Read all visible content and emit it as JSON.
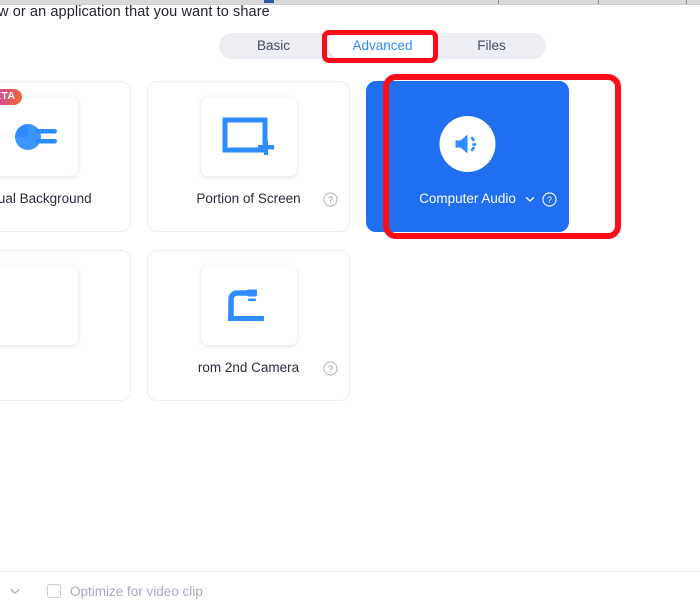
{
  "header": {
    "title": "w or an application that you want to share"
  },
  "tabs": {
    "items": [
      {
        "label": "Basic",
        "active": false
      },
      {
        "label": "Advanced",
        "active": true
      },
      {
        "label": "Files",
        "active": false
      }
    ],
    "active_label": "Advanced"
  },
  "cards": [
    {
      "label": "s Virtual Background",
      "icon": "slides-virtual-background-icon",
      "badge": "BETA",
      "selected": false,
      "has_help": false,
      "has_chevron": false
    },
    {
      "label": "Portion of Screen",
      "icon": "portion-of-screen-icon",
      "badge": null,
      "selected": false,
      "has_help": true,
      "has_chevron": false
    },
    {
      "label": "Computer Audio",
      "icon": "speaker-icon",
      "badge": null,
      "selected": true,
      "has_help": true,
      "has_chevron": true
    },
    {
      "label": "",
      "icon": "blank-icon",
      "badge": null,
      "selected": false,
      "has_help": false,
      "has_chevron": false
    },
    {
      "label": "rom 2nd Camera",
      "icon": "document-camera-icon",
      "badge": null,
      "selected": false,
      "has_help": true,
      "has_chevron": false
    }
  ],
  "footer": {
    "optimize_label": "Optimize for video clip",
    "optimize_checked": false
  },
  "colors": {
    "accent_blue": "#2d8cff",
    "selected_card_blue": "#1f6ff0",
    "annotation_red": "#fc0d1c",
    "tabbar_bg": "#eceef4",
    "muted_text": "#a9a9be"
  }
}
